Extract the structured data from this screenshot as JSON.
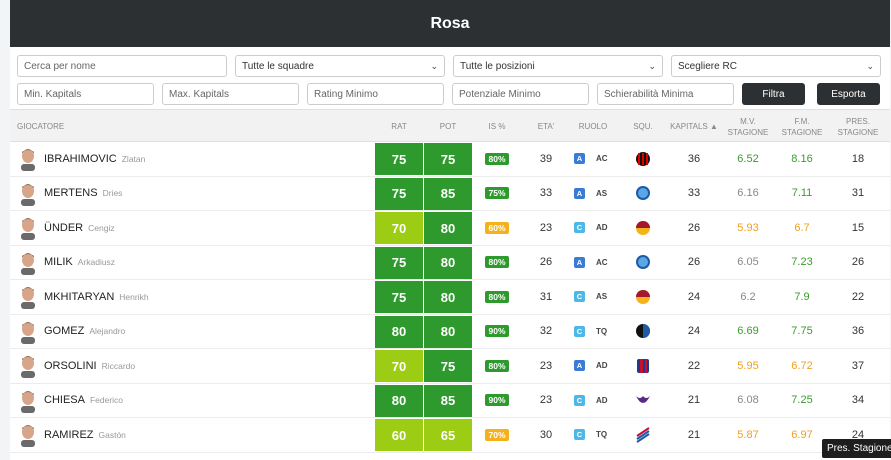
{
  "header": {
    "title": "Rosa"
  },
  "filters": {
    "search_placeholder": "Cerca per nome",
    "team_select": "Tutte le squadre",
    "position_select": "Tutte le posizioni",
    "rc_select": "Scegliere RC",
    "min_kapitals_placeholder": "Min. Kapitals",
    "max_kapitals_placeholder": "Max. Kapitals",
    "rating_min_placeholder": "Rating Minimo",
    "potential_min_placeholder": "Potenziale Minimo",
    "deploy_min_placeholder": "Schierabilità Minima",
    "filter_label": "Filtra",
    "export_label": "Esporta"
  },
  "table": {
    "headers": {
      "player": "GIOCATORE",
      "rat": "RAT",
      "pot": "POT",
      "is": "IS %",
      "age": "ETA'",
      "role": "RUOLO",
      "team": "SQU.",
      "kapitals": "KAPITALS ▲",
      "mv": "M.V. STAGIONE",
      "fm": "F.M. STAGIONE",
      "pres": "PRES. STAGIONE"
    },
    "rows": [
      {
        "surname": "IBRAHIMOVIC",
        "first": "Zlatan",
        "rat": "75",
        "pot": "75",
        "is": "80%",
        "age": "39",
        "role_letter": "A",
        "pos": "AC",
        "club_icon": "milan-crest-icon",
        "kapitals": "36",
        "mv": "6.52",
        "fm": "8.16",
        "pres": "18"
      },
      {
        "surname": "MERTENS",
        "first": "Dries",
        "rat": "75",
        "pot": "85",
        "is": "75%",
        "age": "33",
        "role_letter": "A",
        "pos": "AS",
        "club_icon": "napoli-crest-icon",
        "kapitals": "33",
        "mv": "6.16",
        "fm": "7.11",
        "pres": "31"
      },
      {
        "surname": "ÜNDER",
        "first": "Cengiz",
        "rat": "70",
        "pot": "80",
        "is": "60%",
        "age": "23",
        "role_letter": "C",
        "pos": "AD",
        "club_icon": "roma-crest-icon",
        "kapitals": "26",
        "mv": "5.93",
        "fm": "6.7",
        "pres": "15"
      },
      {
        "surname": "MILIK",
        "first": "Arkadiusz",
        "rat": "75",
        "pot": "80",
        "is": "80%",
        "age": "26",
        "role_letter": "A",
        "pos": "AC",
        "club_icon": "napoli-crest-icon",
        "kapitals": "26",
        "mv": "6.05",
        "fm": "7.23",
        "pres": "26"
      },
      {
        "surname": "MKHITARYAN",
        "first": "Henrikh",
        "rat": "75",
        "pot": "80",
        "is": "80%",
        "age": "31",
        "role_letter": "C",
        "pos": "AS",
        "club_icon": "roma-crest-icon",
        "kapitals": "24",
        "mv": "6.2",
        "fm": "7.9",
        "pres": "22"
      },
      {
        "surname": "GOMEZ",
        "first": "Alejandro",
        "rat": "80",
        "pot": "80",
        "is": "90%",
        "age": "32",
        "role_letter": "C",
        "pos": "TQ",
        "club_icon": "atalanta-crest-icon",
        "kapitals": "24",
        "mv": "6.69",
        "fm": "7.75",
        "pres": "36"
      },
      {
        "surname": "ORSOLINI",
        "first": "Riccardo",
        "rat": "70",
        "pot": "75",
        "is": "80%",
        "age": "23",
        "role_letter": "A",
        "pos": "AD",
        "club_icon": "bologna-crest-icon",
        "kapitals": "22",
        "mv": "5.95",
        "fm": "6.72",
        "pres": "37"
      },
      {
        "surname": "CHIESA",
        "first": "Federico",
        "rat": "80",
        "pot": "85",
        "is": "90%",
        "age": "23",
        "role_letter": "C",
        "pos": "AD",
        "club_icon": "fiorentina-crest-icon",
        "kapitals": "21",
        "mv": "6.08",
        "fm": "7.25",
        "pres": "34"
      },
      {
        "surname": "RAMIREZ",
        "first": "Gastón",
        "rat": "60",
        "pot": "65",
        "is": "70%",
        "age": "30",
        "role_letter": "C",
        "pos": "TQ",
        "club_icon": "sampdoria-crest-icon",
        "kapitals": "21",
        "mv": "5.87",
        "fm": "6.97",
        "pres": "24"
      }
    ]
  },
  "tooltip": {
    "text": "Pres. Stagione"
  },
  "colors": {
    "header_bg": "#2d3033",
    "rating_high": "#2e9a2e",
    "rating_mid": "#9ccc13",
    "role_a": "#3a7bd5",
    "role_c": "#4db8e8",
    "value_good": "#3a9c2e",
    "value_neutral": "#888888",
    "value_warn": "#f0a020",
    "badge_warn": "#f3b21b"
  }
}
